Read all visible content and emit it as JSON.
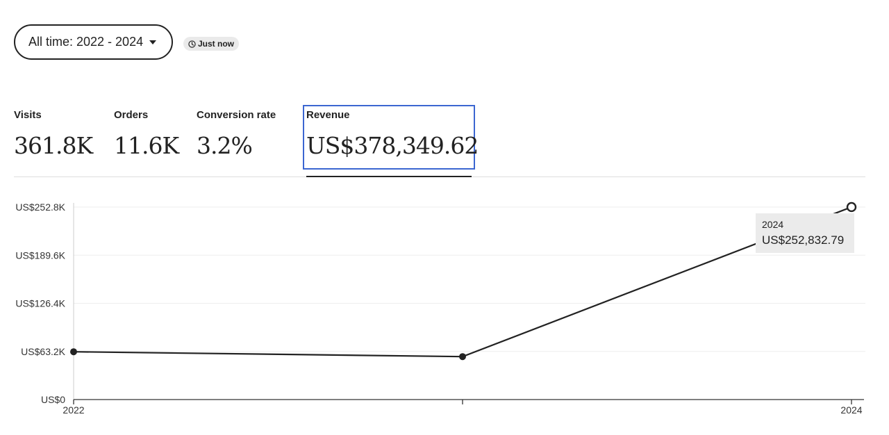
{
  "filters": {
    "date_range_label": "All time: 2022 - 2024",
    "updated_label": "Just now"
  },
  "stats": {
    "visits": {
      "label": "Visits",
      "value": "361.8K"
    },
    "orders": {
      "label": "Orders",
      "value": "11.6K"
    },
    "conversion": {
      "label": "Conversion rate",
      "value": "3.2%"
    },
    "revenue": {
      "label": "Revenue",
      "value": "US$378,349.62"
    }
  },
  "tooltip": {
    "label": "2024",
    "value": "US$252,832.79"
  },
  "colors": {
    "line": "#222222",
    "grid": "#eeeeee",
    "axis": "#333333",
    "selection": "#3b66d1"
  },
  "icons": {
    "updated": "clock-icon",
    "dropdown": "caret-down-icon"
  },
  "chart_data": {
    "type": "line",
    "x": [
      2022,
      2023,
      2024
    ],
    "x_tick_labels": [
      "2022",
      "",
      "2024"
    ],
    "series": [
      {
        "values": [
          62800,
          56400,
          252832.79
        ]
      }
    ],
    "y_ticks": [
      0,
      63200,
      126400,
      189600,
      252800
    ],
    "y_tick_labels": [
      "US$0",
      "US$63.2K",
      "US$126.4K",
      "US$189.6K",
      "US$252.8K"
    ],
    "ylim": [
      0,
      252800
    ],
    "grid": true,
    "highlighted_point": {
      "x": 2024,
      "y": 252832.79
    }
  }
}
